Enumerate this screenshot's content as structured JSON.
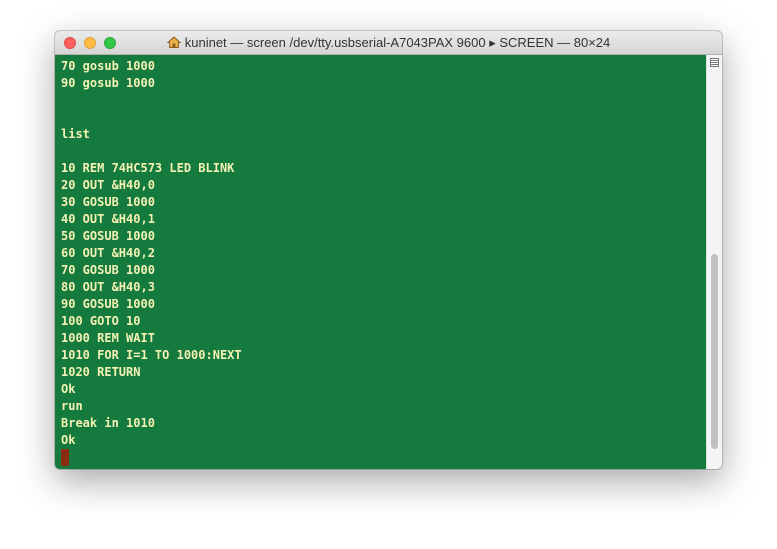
{
  "window": {
    "title": "kuninet — screen /dev/tty.usbserial-A7043PAX 9600 ▸ SCREEN — 80×24",
    "icon": "home-icon"
  },
  "colors": {
    "terminal_background": "#157a3e",
    "terminal_text": "#f4f1b5",
    "cursor": "#8b2b12"
  },
  "terminal": {
    "lines": [
      "70 gosub 1000",
      "90 gosub 1000",
      "",
      "",
      "list",
      "",
      "10 REM 74HC573 LED BLINK",
      "20 OUT &H40,0",
      "30 GOSUB 1000",
      "40 OUT &H40,1",
      "50 GOSUB 1000",
      "60 OUT &H40,2",
      "70 GOSUB 1000",
      "80 OUT &H40,3",
      "90 GOSUB 1000",
      "100 GOTO 10",
      "1000 REM WAIT",
      "1010 FOR I=1 TO 1000:NEXT",
      "1020 RETURN",
      "Ok",
      "run",
      "Break in 1010",
      "Ok"
    ],
    "scroll_position": 0.92
  }
}
